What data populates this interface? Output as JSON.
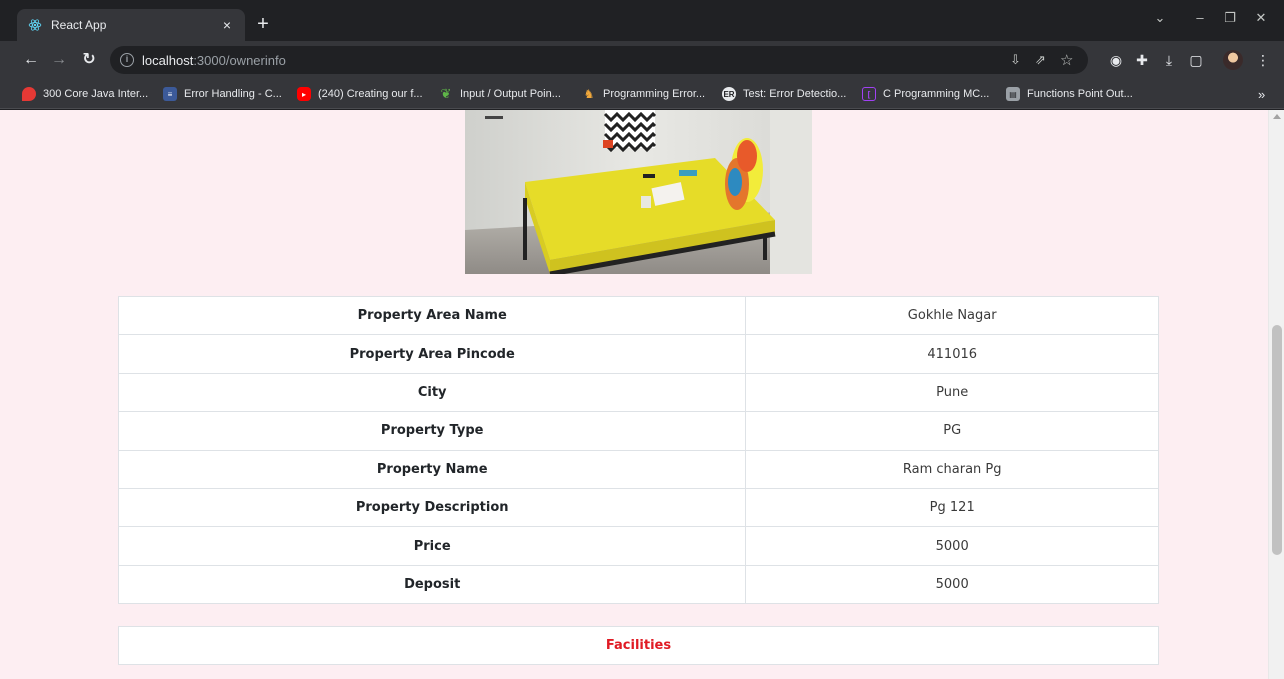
{
  "browser": {
    "tab_title": "React App",
    "tab_close": "×",
    "new_tab": "+",
    "url_host": "localhost",
    "url_path": ":3000/ownerinfo",
    "window_controls": [
      "⌄",
      "–",
      "❐",
      "✕"
    ]
  },
  "bookmarks": [
    {
      "label": "300 Core Java Inter...",
      "icon": "heart-icon",
      "color": "#e53935"
    },
    {
      "label": "Error Handling - C...",
      "icon": "site-icon",
      "color": "#3c5a99"
    },
    {
      "label": "(240) Creating our f...",
      "icon": "youtube-icon",
      "color": "#ff0000"
    },
    {
      "label": "Input / Output Poin...",
      "icon": "tutorialspoint-icon",
      "color": "#5fb548"
    },
    {
      "label": "Programming Error...",
      "icon": "bag-icon",
      "color": "#f2a93b"
    },
    {
      "label": "Test: Error Detectio...",
      "icon": "er-icon",
      "color": "#5f6368"
    },
    {
      "label": "C Programming MC...",
      "icon": "bracket-icon",
      "color": "#a142f4"
    },
    {
      "label": "Functions Point Out...",
      "icon": "book-icon",
      "color": "#9aa0a6"
    }
  ],
  "property": {
    "rows": [
      {
        "label": "Property Area Name",
        "value": "Gokhle Nagar"
      },
      {
        "label": "Property Area Pincode",
        "value": "411016"
      },
      {
        "label": "City",
        "value": "Pune"
      },
      {
        "label": "Property Type",
        "value": "PG"
      },
      {
        "label": "Property Name",
        "value": "Ram charan Pg"
      },
      {
        "label": "Property Description",
        "value": "Pg 121"
      },
      {
        "label": "Price",
        "value": "5000"
      },
      {
        "label": "Deposit",
        "value": "5000"
      }
    ],
    "facilities_heading": "Facilities"
  },
  "colors": {
    "page_background": "#fdeef2",
    "facilities_heading": "#e01b24"
  }
}
